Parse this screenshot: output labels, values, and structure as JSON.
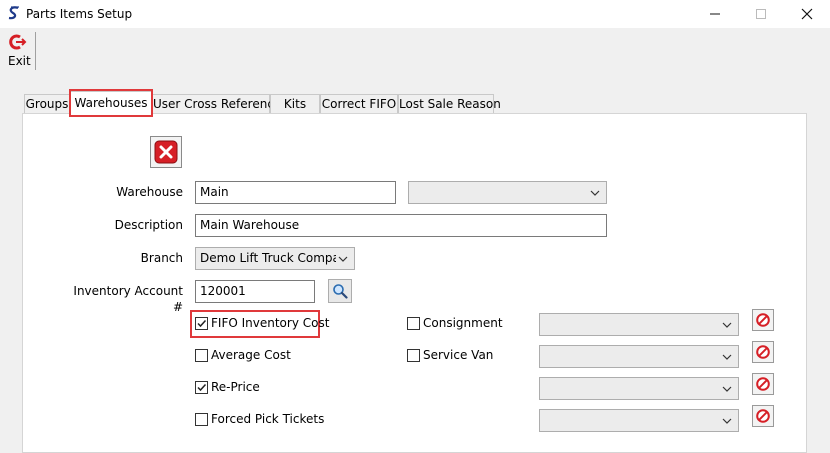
{
  "window": {
    "title": "Parts Items Setup",
    "minimize_glyph": "—",
    "maximize_glyph": "☐",
    "close_glyph": "✕"
  },
  "toolbar": {
    "exit_label": "Exit"
  },
  "tabs": [
    {
      "label": "Groups"
    },
    {
      "label": "Warehouses",
      "selected": true
    },
    {
      "label": "User Cross Reference"
    },
    {
      "label": "Kits"
    },
    {
      "label": "Correct FIFO"
    },
    {
      "label": "Lost Sale Reason"
    }
  ],
  "form": {
    "warehouse": {
      "label": "Warehouse",
      "value": "Main",
      "secondary_value": ""
    },
    "description": {
      "label": "Description",
      "value": "Main Warehouse"
    },
    "branch": {
      "label": "Branch",
      "value": "Demo Lift Truck Company"
    },
    "inventory_account": {
      "label": "Inventory Account #",
      "value": "120001"
    },
    "left_checks": [
      {
        "label": "FIFO Inventory Cost",
        "checked": true
      },
      {
        "label": "Average Cost",
        "checked": false
      },
      {
        "label": "Re-Price",
        "checked": true
      },
      {
        "label": "Forced Pick Tickets",
        "checked": false
      }
    ],
    "right_checks": [
      {
        "label": "Consignment",
        "checked": false,
        "value": ""
      },
      {
        "label": "Service Van",
        "checked": false,
        "value": ""
      }
    ]
  },
  "colors": {
    "highlight": "#e0393b",
    "accent_icon": "#d61f26"
  }
}
